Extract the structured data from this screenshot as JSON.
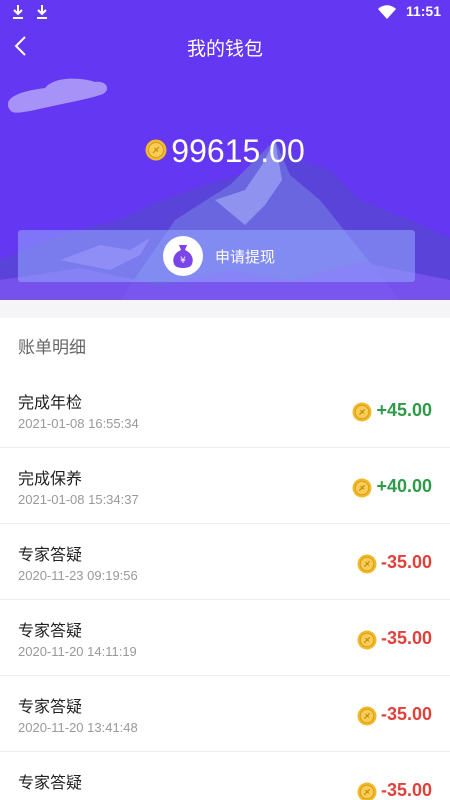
{
  "status_bar": {
    "time": "11:51",
    "icons": [
      "download-icon",
      "download-icon",
      "wifi-icon"
    ]
  },
  "nav": {
    "back_icon": "chevron-left-icon",
    "title": "我的钱包"
  },
  "wallet": {
    "balance": "99615.00",
    "coin_icon": "gold-coin-icon",
    "withdraw_label": "申请提现",
    "withdraw_icon": "money-bag-icon"
  },
  "bills": {
    "title": "账单明细",
    "items": [
      {
        "title": "完成年检",
        "date": "2021-01-08 16:55:34",
        "amount": "+45.00",
        "type": "income"
      },
      {
        "title": "完成保养",
        "date": "2021-01-08 15:34:37",
        "amount": "+40.00",
        "type": "income"
      },
      {
        "title": "专家答疑",
        "date": "2020-11-23 09:19:56",
        "amount": "-35.00",
        "type": "expense"
      },
      {
        "title": "专家答疑",
        "date": "2020-11-20 14:11:19",
        "amount": "-35.00",
        "type": "expense"
      },
      {
        "title": "专家答疑",
        "date": "2020-11-20 13:41:48",
        "amount": "-35.00",
        "type": "expense"
      },
      {
        "title": "专家答疑",
        "date": "",
        "amount": "-35.00",
        "type": "expense"
      }
    ]
  },
  "colors": {
    "header_bg": "#6437f2",
    "income": "#2f9a49",
    "expense": "#e0413a",
    "coin": "#f2b92a"
  }
}
